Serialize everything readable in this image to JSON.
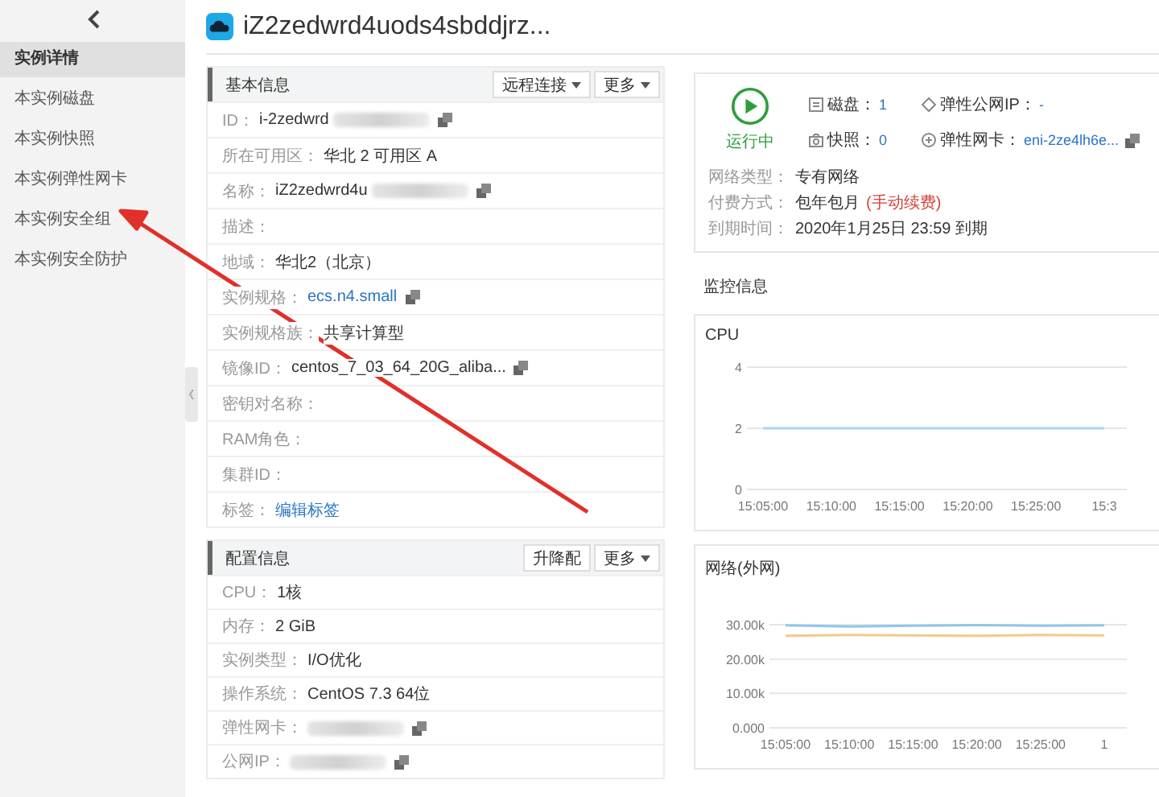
{
  "sidebar": {
    "items": [
      {
        "label": "实例详情",
        "selected": true
      },
      {
        "label": "本实例磁盘",
        "selected": false
      },
      {
        "label": "本实例快照",
        "selected": false
      },
      {
        "label": "本实例弹性网卡",
        "selected": false
      },
      {
        "label": "本实例安全组",
        "selected": false
      },
      {
        "label": "本实例安全防护",
        "selected": false
      }
    ]
  },
  "title": "iZ2zedwrd4uods4sbddjrz...",
  "basic_info": {
    "title": "基本信息",
    "buttons": [
      {
        "label": "远程连接",
        "dropdown": true
      },
      {
        "label": "更多",
        "dropdown": true
      }
    ],
    "rows": [
      {
        "label": "ID：",
        "value": "i-2zedwrd",
        "redacted": true,
        "copy": true
      },
      {
        "label": "所在可用区：",
        "value": "华北 2 可用区 A"
      },
      {
        "label": "名称：",
        "value": "iZ2zedwrd4u",
        "redacted": true,
        "copy": true
      },
      {
        "label": "描述："
      },
      {
        "label": "地域：",
        "value": "华北2（北京）"
      },
      {
        "label": "实例规格：",
        "value": "ecs.n4.small",
        "link": true,
        "copy": true
      },
      {
        "label": "实例规格族：",
        "value": "共享计算型"
      },
      {
        "label": "镜像ID：",
        "value": "centos_7_03_64_20G_aliba...",
        "copy": true
      },
      {
        "label": "密钥对名称："
      },
      {
        "label": "RAM角色："
      },
      {
        "label": "集群ID："
      },
      {
        "label": "标签：",
        "value": "编辑标签",
        "link": true
      }
    ]
  },
  "config_info": {
    "title": "配置信息",
    "buttons": [
      {
        "label": "升降配",
        "dropdown": false
      },
      {
        "label": "更多",
        "dropdown": true
      }
    ],
    "rows": [
      {
        "label": "CPU：",
        "value": "1核"
      },
      {
        "label": "内存：",
        "value": "2 GiB"
      },
      {
        "label": "实例类型：",
        "value": "I/O优化"
      },
      {
        "label": "操作系统：",
        "value": "CentOS 7.3 64位"
      },
      {
        "label": "弹性网卡：",
        "redacted": true,
        "copy": true
      },
      {
        "label": "公网IP：",
        "redacted": true,
        "copy": true
      }
    ]
  },
  "status": {
    "label": "运行中",
    "kind": "running"
  },
  "stats": [
    {
      "kind": "disk",
      "label": "磁盘：",
      "value": "1"
    },
    {
      "kind": "eip",
      "label": "弹性公网IP：",
      "value": "-"
    },
    {
      "kind": "snapshot",
      "label": "快照：",
      "value": "0"
    },
    {
      "kind": "eni",
      "label": "弹性网卡：",
      "value": "eni-2ze4lh6e...",
      "copy": true
    }
  ],
  "details": [
    {
      "label": "网络类型：",
      "value": "专有网络"
    },
    {
      "label": "付费方式：",
      "value": "包年包月",
      "note": "(手动续费)"
    },
    {
      "label": "到期时间：",
      "value": "2020年1月25日 23:59 到期"
    }
  ],
  "monitor": {
    "title": "监控信息",
    "charts": [
      {
        "title": "CPU",
        "chart_data": {
          "type": "line",
          "grid": true,
          "categories": [
            "15:05:00",
            "15:10:00",
            "15:15:00",
            "15:20:00",
            "15:25:00",
            "15:3"
          ],
          "ylim": [
            0,
            4
          ],
          "yticks": [
            0,
            2,
            4
          ],
          "series": [
            {
              "color": "#a9d6ee",
              "values": [
                2,
                2,
                2,
                2,
                2,
                2
              ]
            }
          ]
        }
      },
      {
        "title": "网络(外网)",
        "chart_data": {
          "type": "line",
          "categories": [
            "15:05:00",
            "15:10:00",
            "15:15:00",
            "15:20:00",
            "15:25:00",
            "1"
          ],
          "grid": true,
          "ylim": [
            0,
            30000
          ],
          "yticks": [
            {
              "value": 0,
              "label": "0.000"
            },
            {
              "value": 10000,
              "label": "10.00k"
            },
            {
              "value": 20000,
              "label": "20.00k"
            },
            {
              "value": 30000,
              "label": "30.00k"
            }
          ],
          "series": [
            {
              "color": "#8fc7e8",
              "values": [
                29800,
                29500,
                29700,
                29900,
                29700,
                29800
              ]
            },
            {
              "color": "#f2c98a",
              "values": [
                26800,
                27000,
                26900,
                26800,
                27000,
                26900
              ]
            }
          ]
        }
      }
    ]
  }
}
